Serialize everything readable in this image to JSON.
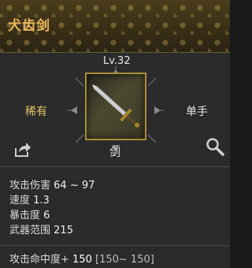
{
  "item": {
    "name": "犬齿剑",
    "level": "Lv.32",
    "rarity": "稀有",
    "hand": "单手",
    "type": "剑"
  },
  "icons": {
    "share": "share-icon",
    "search": "magnifier-icon",
    "item": "sword-icon"
  },
  "stats": [
    {
      "label": "攻击伤害",
      "value": "64 ~ 97"
    },
    {
      "label": "速度",
      "value": "1.3"
    },
    {
      "label": "暴击度",
      "value": "6"
    },
    {
      "label": "武器范围",
      "value": "215"
    }
  ],
  "accuracy": {
    "label": "攻击命中度+",
    "value": "150",
    "range": "[150~ 150]"
  },
  "colors": {
    "title": "#e9b85c",
    "rarity": "#e6c56a",
    "frame": "#a98c3a"
  }
}
